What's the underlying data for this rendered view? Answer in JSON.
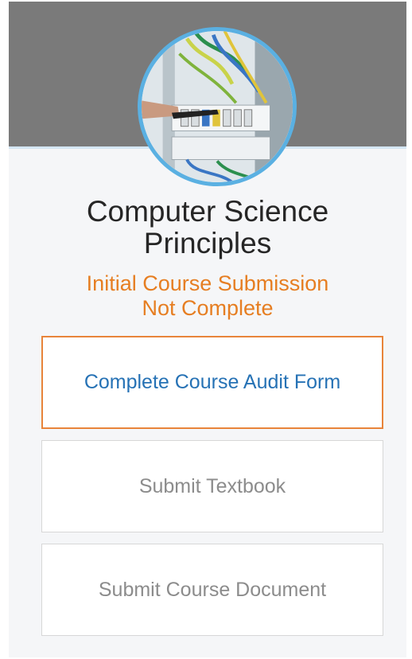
{
  "course": {
    "title_line1": "Computer Science",
    "title_line2": "Principles",
    "status_line1": "Initial Course Submission",
    "status_line2": "Not Complete"
  },
  "actions": {
    "audit_label": "Complete Course Audit Form",
    "textbook_label": "Submit Textbook",
    "document_label": "Submit Course Document"
  },
  "colors": {
    "banner": "#7a7a7a",
    "avatar_ring": "#5ab0e2",
    "status": "#e67e22",
    "primary_border": "#e8843a",
    "primary_text": "#2672b5"
  },
  "icons": {
    "avatar": "server-rack-cables-photo"
  }
}
